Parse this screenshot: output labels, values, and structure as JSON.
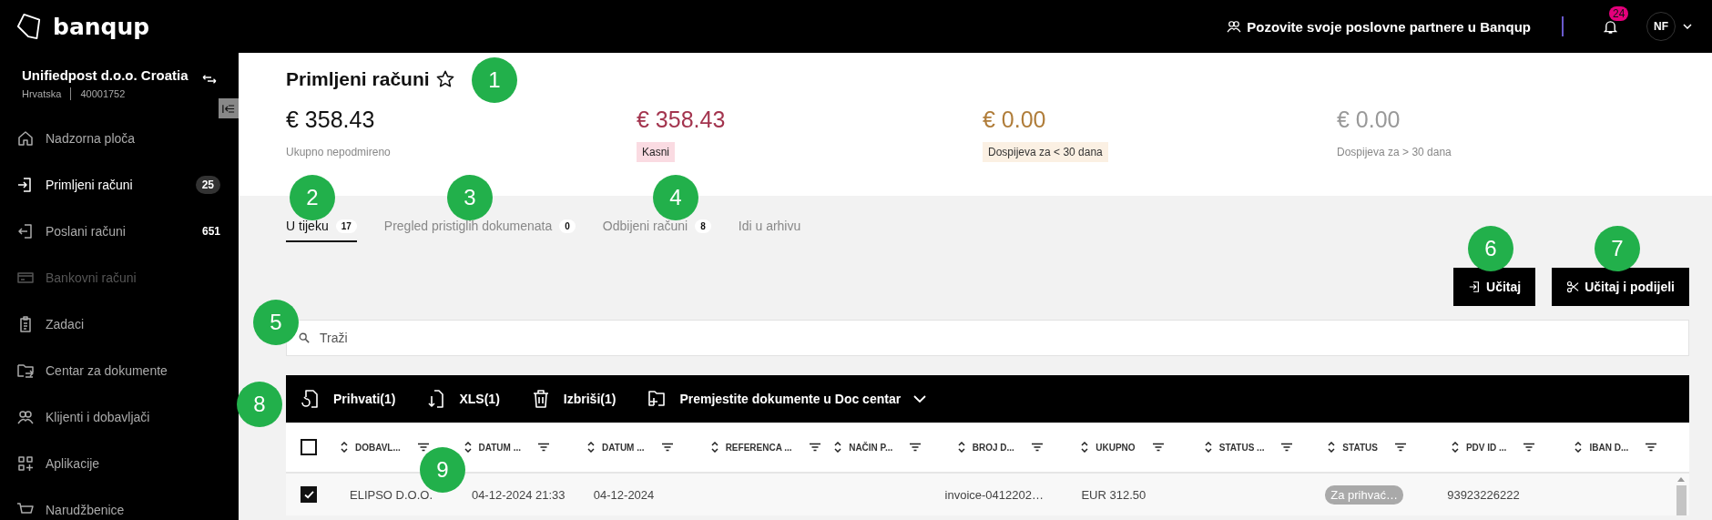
{
  "topbar": {
    "logo": "banqup",
    "invite": "Pozovite svoje poslovne partnere u Banqup",
    "notifications": "24",
    "avatar": "NF"
  },
  "company": {
    "name": "Unifiedpost d.o.o. Croatia",
    "country": "Hrvatska",
    "id": "40001752"
  },
  "sidebar": {
    "items": [
      {
        "label": "Nadzorna ploča",
        "selected": false,
        "disabled": false
      },
      {
        "label": "Primljeni računi",
        "selected": true,
        "disabled": false,
        "badge": "25"
      },
      {
        "label": "Poslani računi",
        "selected": false,
        "disabled": false,
        "badge": "651"
      },
      {
        "label": "Bankovni računi",
        "selected": false,
        "disabled": true
      },
      {
        "label": "Zadaci",
        "selected": false,
        "disabled": false
      },
      {
        "label": "Centar za dokumente",
        "selected": false,
        "disabled": false
      },
      {
        "label": "Klijenti i dobavljači",
        "selected": false,
        "disabled": false
      },
      {
        "label": "Aplikacije",
        "selected": false,
        "disabled": false
      },
      {
        "label": "Narudžbenice",
        "selected": false,
        "disabled": false
      }
    ]
  },
  "page": {
    "title": "Primljeni računi",
    "favorite": false
  },
  "stats": [
    {
      "amount": "€ 358.43",
      "label": "Ukupno nepodmireno",
      "kind": "plain"
    },
    {
      "amount": "€ 358.43",
      "label": "Kasni",
      "kind": "overdue"
    },
    {
      "amount": "€ 0.00",
      "label": "Dospijeva za < 30 dana",
      "kind": "soon"
    },
    {
      "amount": "€ 0.00",
      "label": "Dospijeva za > 30 dana",
      "kind": "muted"
    }
  ],
  "tabs": [
    {
      "label": "U tijeku",
      "count": "17",
      "selected": true
    },
    {
      "label": "Pregled pristiglih dokumenata",
      "count": "0",
      "selected": false
    },
    {
      "label": "Odbijeni računi",
      "count": "8",
      "selected": false
    },
    {
      "label": "Idi u arhivu",
      "selected": false
    }
  ],
  "buttons": [
    {
      "label": "Učitaj"
    },
    {
      "label": "Učitaj i podijeli"
    }
  ],
  "search": {
    "placeholder": "Traži"
  },
  "bulk_actions": [
    {
      "label": "Prihvati(1)",
      "dropdown": false
    },
    {
      "label": "XLS(1)",
      "dropdown": false
    },
    {
      "label": "Izbriši(1)",
      "dropdown": false
    },
    {
      "label": "Premjestite dokumente u Doc centar",
      "dropdown": true
    }
  ],
  "table": {
    "all_checked": false,
    "columns": [
      "DOBAVL...",
      "DATUM ...",
      "DATUM ...",
      "REFERENCA ...",
      "NAČIN P...",
      "BROJ D...",
      "UKUPNO",
      "STATUS ...",
      "STATUS",
      "PDV ID ...",
      "IBAN D..."
    ],
    "rows": [
      {
        "checked": true,
        "cells": [
          {
            "kind": "text",
            "text": "ELIPSO D.O.O."
          },
          {
            "kind": "text",
            "text": "04-12-2024 21:33"
          },
          {
            "kind": "text",
            "text": "04-12-2024"
          },
          {
            "kind": "blank"
          },
          {
            "kind": "blank"
          },
          {
            "kind": "text",
            "text": "invoice-0412202…"
          },
          {
            "kind": "text",
            "text": "EUR 312.50"
          },
          {
            "kind": "blank"
          },
          {
            "kind": "pill",
            "text": "Za prihvać…"
          },
          {
            "kind": "text",
            "text": "93923226222"
          },
          {
            "kind": "blank"
          }
        ]
      }
    ]
  },
  "callouts": [
    "1",
    "2",
    "3",
    "4",
    "5",
    "6",
    "7",
    "8",
    "9"
  ]
}
